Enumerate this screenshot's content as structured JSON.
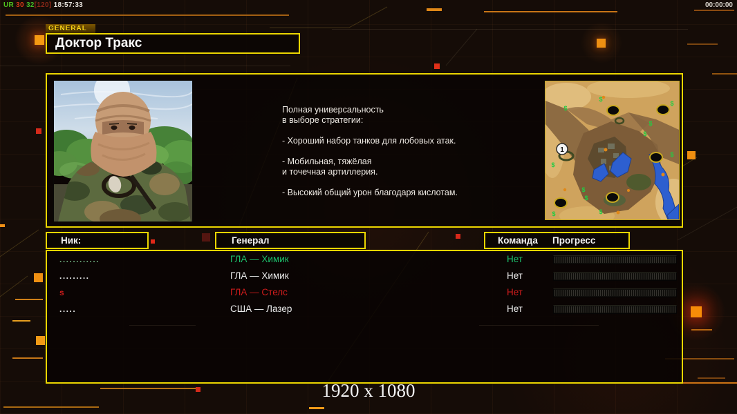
{
  "hud": {
    "debug": [
      {
        "text": "UR",
        "color": "#4fc41e"
      },
      {
        "text": " 30",
        "color": "#d83a18"
      },
      {
        "text": " 32",
        "color": "#44bc28"
      },
      {
        "text": "[120]",
        "color": "#8a2818"
      },
      {
        "text": " 18:57:33",
        "color": "#e8e4de"
      }
    ],
    "clock": "00:00:00",
    "resolution_label": "1920 x 1080"
  },
  "header": {
    "tag": "GENERAL",
    "title": "Доктор Тракс"
  },
  "profile": {
    "description": "Полная универсальность\nв выборе стратегии:\n\n- Хороший набор танков для лобовых атак.\n\n- Мобильная, тяжёлая\nи точечная артиллерия.\n\n- Высокий общий урон благодаря кислотам.",
    "map": {
      "start_number": "1",
      "resource_symbol": "$"
    }
  },
  "table": {
    "headers": {
      "nick": "Ник:",
      "general": "Генерал",
      "team": "Команда",
      "progress": "Прогресс"
    },
    "rows": [
      {
        "nick": "............",
        "nick_color": "#6aa87a",
        "general": "ГЛА — Химик",
        "team": "Нет",
        "color": "#1cc06c",
        "progress_percent": 0
      },
      {
        "nick": ".........",
        "nick_color": "#ebebeb",
        "general": "ГЛА — Химик",
        "team": "Нет",
        "color": "#ebebeb",
        "progress_percent": 0
      },
      {
        "nick": "s",
        "nick_color": "#d01c1c",
        "general": "ГЛА — Стелс",
        "team": "Нет",
        "color": "#d01c1c",
        "progress_percent": 0
      },
      {
        "nick": ".....",
        "nick_color": "#ebebeb",
        "general": "США — Лазер",
        "team": "Нет",
        "color": "#ebebeb",
        "progress_percent": 0
      }
    ]
  },
  "colors": {
    "accent_border": "#ecd600",
    "decor_orange": "#ef9012",
    "decor_red": "#d42a1a"
  }
}
